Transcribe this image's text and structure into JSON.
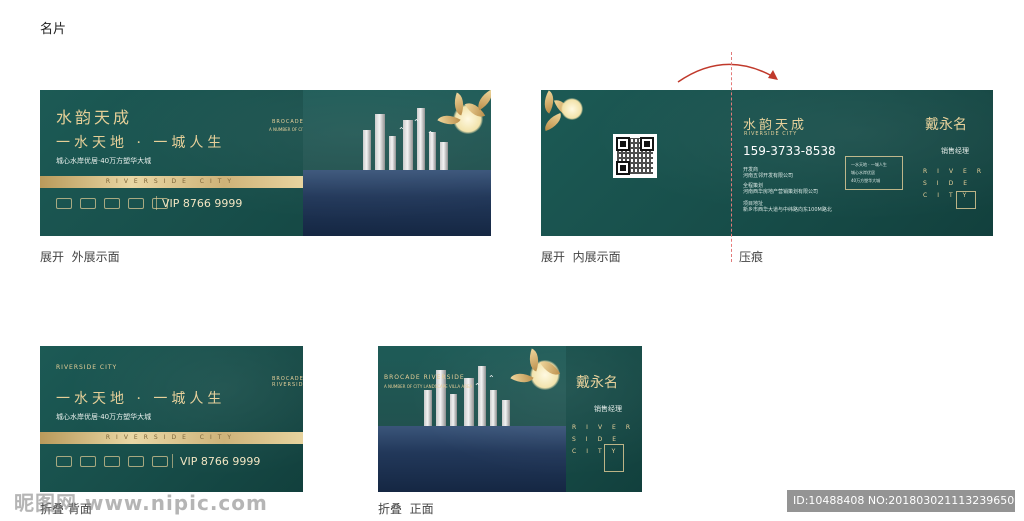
{
  "page_title": "名片",
  "captions": {
    "outer": "展开  外展示面",
    "inner": "展开  内展示面",
    "crease": "压痕",
    "fold_back": "折叠 背面",
    "fold_front": "折叠  正面"
  },
  "brand": {
    "logo": "水韵天成",
    "logo_en": "RIVERSIDE CITY",
    "slogan": "一水天地 · 一城人生",
    "tagline": "城心水岸优居·40万方塑华大城",
    "band_text": "RIVERSIDE CITY",
    "hotline": "VIP 8766 9999",
    "scene_title": "BROCADE RIVERSIDE",
    "scene_sub": "A NUMBER OF CITY LANDSCAPE VILLA AREA"
  },
  "contact": {
    "name": "戴永名",
    "title": "销售经理",
    "phone": "159-3733-8538",
    "label_developer": "开发商",
    "developer": "河南五邻开发有限公司",
    "label_agent": "全程策划",
    "agent": "河南西华房地产营销策划有限公司",
    "label_address": "项目地址",
    "address": "新乡市西华大道与中纬路向东100M路北",
    "box_line1": "一水天地 · 一城人生",
    "box_line2": "城心水岸优居",
    "box_line3": "40万方塑华大城",
    "river_letters": [
      "RIVER",
      "SIDE",
      "CITY"
    ]
  },
  "watermark": {
    "left": "昵图网 www.nipic.com",
    "right": "ID:10488408 NO:20180302111323965039"
  },
  "colors": {
    "card_teal": "#174d49",
    "gold": "#e6cf97",
    "fold_arrow": "#c0392b"
  }
}
